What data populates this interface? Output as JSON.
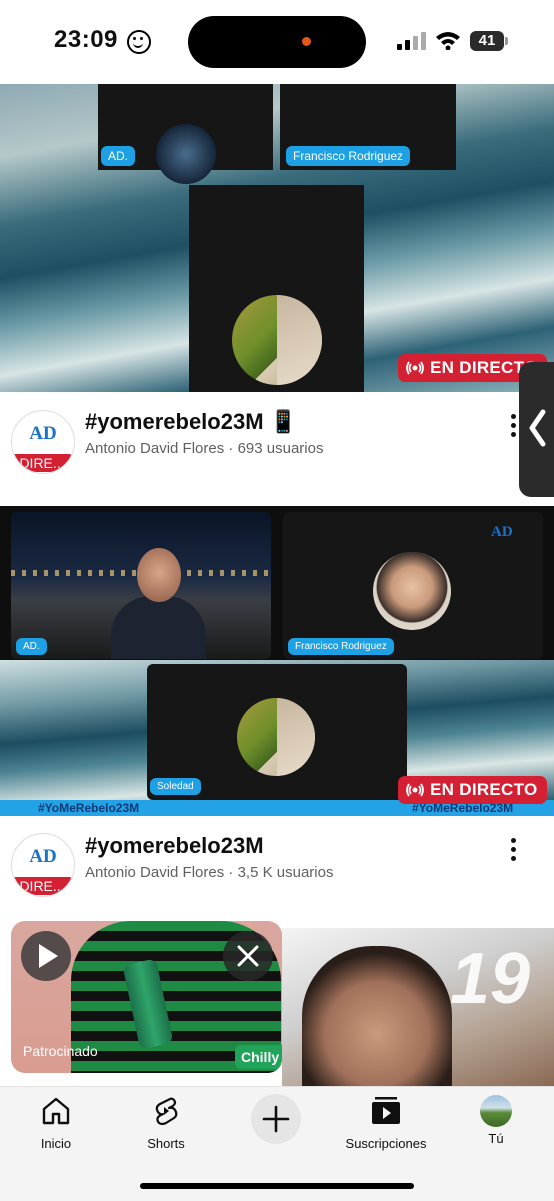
{
  "status_bar": {
    "time": "23:09",
    "battery": "41"
  },
  "video1": {
    "participants": [
      "AD.",
      "Francisco Rodriguez"
    ],
    "live_badge": "EN DIRECTO",
    "channel_logo_text": "AD",
    "channel_live_text": "DIRE...",
    "title": "#yomerebelo23M 📱",
    "meta": "Antonio David Flores · 693 usuarios"
  },
  "video2": {
    "participants": [
      "AD.",
      "Francisco Rodriguez",
      "Soledad"
    ],
    "hashtag_strip": [
      "#YoMeRebelo23M",
      "#YoMeRebelo23M"
    ],
    "live_badge": "EN DIRECTO",
    "channel_logo_text": "AD",
    "channel_live_text": "DIRE...",
    "title": "#yomerebelo23M",
    "meta": "Antonio David Flores · 3,5 K usuarios"
  },
  "ad": {
    "label": "Patrocinado",
    "brand": "Chilly",
    "background_number": "19"
  },
  "bottom_nav": [
    {
      "label": "Inicio",
      "icon": "home-icon"
    },
    {
      "label": "Shorts",
      "icon": "shorts-icon"
    },
    {
      "label": "",
      "icon": "create-icon"
    },
    {
      "label": "Suscripciones",
      "icon": "subscriptions-icon"
    },
    {
      "label": "Tú",
      "icon": "you-avatar"
    }
  ],
  "colors": {
    "live_red": "#d42033",
    "name_pill_blue": "#1ea0e5"
  }
}
